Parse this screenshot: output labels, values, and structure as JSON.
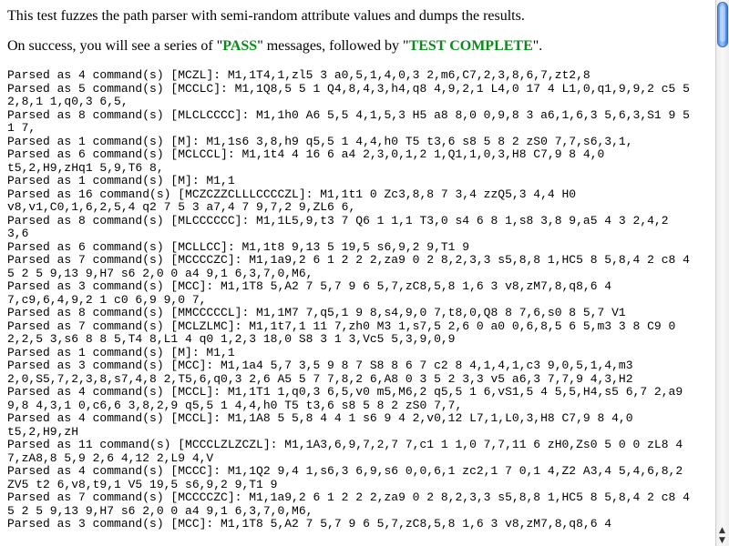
{
  "intro": {
    "text": "This test fuzzes the path parser with semi-random attribute values and dumps the results."
  },
  "success": {
    "prefix": "On success, you will see a series of \"",
    "pass": "PASS",
    "middle": "\" messages, followed by \"",
    "complete": "TEST COMPLETE",
    "suffix": "\"."
  },
  "results": [
    "Parsed as 4 command(s) [MCZL]: M1,1T4,1,zl5 3 a0,5,1,4,0,3 2,m6,C7,2,3,8,6,7,zt2,8",
    "Parsed as 5 command(s) [MCCLC]: M1,1Q8,5 5 1 Q4,8,4,3,h4,q8 4,9,2,1 L4,0 17 4 L1,0,q1,9,9,2 c5 5",
    "2,8,1 1,q0,3 6,5,",
    "Parsed as 8 command(s) [MLCLCCCC]: M1,1h0 A6 5,5 4,1,5,3 H5 a8 8,0 0,9,8 3 a6,1,6,3 5,6,3,S1 9 5",
    "1 7,",
    "Parsed as 1 command(s) [M]: M1,1s6 3,8,h9 q5,5 1 4,4,h0 T5 t3,6 s8 5 8 2 zS0 7,7,s6,3,1,",
    "Parsed as 6 command(s) [MCLCCL]: M1,1t4 4 16 6 a4 2,3,0,1,2 1,Q1,1,0,3,H8 C7,9 8 4,0",
    "t5,2,H9,zHq1 5,9,T6 8,",
    "Parsed as 1 command(s) [M]: M1,1",
    "Parsed as 16 command(s) [MCZCZZCLLLCCCCZL]: M1,1t1 0 Zc3,8,8 7 3,4 zzQ5,3 4,4 H0",
    "v8,v1,C0,1,6,2,5,4 q2 7 5 3 a7,4 7 9,7,2 9,ZL6 6,",
    "Parsed as 8 command(s) [MLCCCCCC]: M1,1L5,9,t3 7 Q6 1 1,1 T3,0 s4 6 8 1,s8 3,8 9,a5 4 3 2,4,2",
    "3,6",
    "Parsed as 6 command(s) [MCLLCC]: M1,1t8 9,13 5 19,5 s6,9,2 9,T1 9",
    "Parsed as 7 command(s) [MCCCCZC]: M1,1a9,2 6 1 2 2 2,za9 0 2 8,2,3,3 s5,8,8 1,HC5 8 5,8,4 2 c8 4",
    "5 2 5 9,13 9,H7 s6 2,0 0 a4 9,1 6,3,7,0,M6,",
    "Parsed as 3 command(s) [MCC]: M1,1T8 5,A2 7 5,7 9 6 5,7,zC8,5,8 1,6 3 v8,zM7,8,q8,6 4",
    "7,c9,6,4,9,2 1 c0 6,9 9,0 7,",
    "Parsed as 8 command(s) [MMCCCCCL]: M1,1M7 7,q5,1 9 8,s4,9,0 7,t8,0,Q8 8 7,6,s0 8 5,7 V1",
    "Parsed as 7 command(s) [MCLZLMC]: M1,1t7,1 11 7,zh0 M3 1,s7,5 2,6 0 a0 0,6,8,5 6 5,m3 3 8 C9 0",
    "2,2,5 3,s6 8 8 5,T4 8,L1 4 q0 1,2,3 18,0 S8 3 1 3,Vc5 5,3,9,0,9",
    "Parsed as 1 command(s) [M]: M1,1",
    "Parsed as 3 command(s) [MCC]: M1,1a4 5,7 3,5 9 8 7 S8 8 6 7 c2 8 4,1,4,1,c3 9,0,5,1,4,m3",
    "2,0,S5,7,2,3,8,s7,4,8 2,T5,6,q0,3 2,6 A5 5 7 7,8,2 6,A8 0 3 5 2 3,3 v5 a6,3 7,7,9 4,3,H2",
    "Parsed as 4 command(s) [MCCL]: M1,1T1 1,q0,3 6,5,v0 m5,M6,2 q5,5 1 6,vS1,5 4 5,5,H4,s5 6,7 2,a9",
    "9,8 4,3,1 0,c6,6 3,8,2,9 q5,5 1 4,4,h0 T5 t3,6 s8 5 8 2 zS0 7,7,",
    "Parsed as 4 command(s) [MCCL]: M1,1A8 5 5,8 4 4 1 s6 9 4 2,v0,12 L7,1,L0,3,H8 C7,9 8 4,0",
    "t5,2,H9,zH",
    "Parsed as 11 command(s) [MCCCLZLZCZL]: M1,1A3,6,9,7,2,7 7,c1 1 1,0 7,7,11 6 zH0,Zs0 5 0 0 zL8 4",
    "7,zA8,8 5,9 2,6 4,12 2,L9 4,V",
    "Parsed as 4 command(s) [MCCC]: M1,1Q2 9,4 1,s6,3 6,9,s6 0,0,6,1 zc2,1 7 0,1 4,Z2 A3,4 5,4,6,8,2",
    "ZV5 t2 6,v8,t9,1 V5 19,5 s6,9,2 9,T1 9",
    "Parsed as 7 command(s) [MCCCCZC]: M1,1a9,2 6 1 2 2 2,za9 0 2 8,2,3,3 s5,8,8 1,HC5 8 5,8,4 2 c8 4",
    "5 2 5 9,13 9,H7 s6 2,0 0 a4 9,1 6,3,7,0,M6,",
    "Parsed as 3 command(s) [MCC]: M1,1T8 5,A2 7 5,7 9 6 5,7,zC8,5,8 1,6 3 v8,zM7,8,q8,6 4"
  ]
}
